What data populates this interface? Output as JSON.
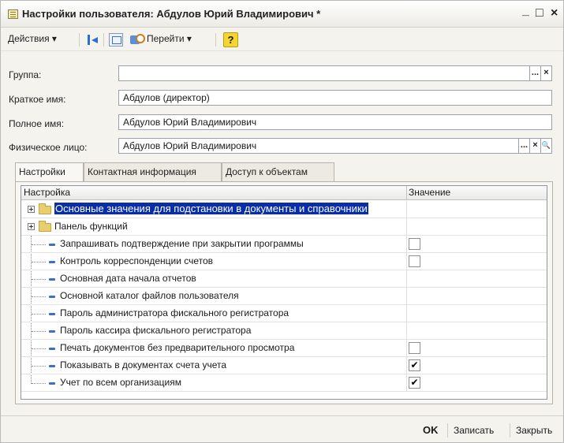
{
  "window": {
    "title": "Настройки пользователя: Абдулов Юрий Владимирович *",
    "minimize": "_",
    "maximize": "□",
    "close": "×"
  },
  "toolbar": {
    "actions_label": "Действия ▾",
    "goto_label": "Перейти ▾",
    "help_label": "?",
    "icons": [
      "back-arrow-icon",
      "edit-form-icon",
      "navigate-icon",
      "help-icon"
    ]
  },
  "form": {
    "group": {
      "label": "Группа:",
      "value": "",
      "select_btn": "...",
      "clear_btn": "×"
    },
    "short_name": {
      "label": "Краткое имя:",
      "value": "Абдулов (директор)"
    },
    "full_name": {
      "label": "Полное имя:",
      "value": "Абдулов Юрий Владимирович"
    },
    "person": {
      "label": "Физическое лицо:",
      "value": "Абдулов Юрий Владимирович",
      "select_btn": "...",
      "clear_btn": "×",
      "open_btn": "🔍"
    }
  },
  "tabs": [
    {
      "label": "Настройки",
      "active": true
    },
    {
      "label": "Контактная информация",
      "active": false
    },
    {
      "label": "Доступ к объектам",
      "active": false
    }
  ],
  "grid": {
    "columns": [
      "Настройка",
      "Значение"
    ],
    "rows": [
      {
        "label": "Основные значения для подстановки в документы и справочники",
        "kind": "folder",
        "selected": true,
        "value": null
      },
      {
        "label": "Панель функций",
        "kind": "folder",
        "selected": false,
        "value": null
      },
      {
        "label": "Запрашивать подтверждение при закрытии программы",
        "kind": "item",
        "value": "unchecked"
      },
      {
        "label": "Контроль корреспонденции счетов",
        "kind": "item",
        "value": "unchecked"
      },
      {
        "label": "Основная дата начала отчетов",
        "kind": "item",
        "value": null
      },
      {
        "label": "Основной каталог файлов пользователя",
        "kind": "item",
        "value": null
      },
      {
        "label": "Пароль администратора фискального регистратора",
        "kind": "item",
        "value": null
      },
      {
        "label": "Пароль кассира фискального регистратора",
        "kind": "item",
        "value": null
      },
      {
        "label": "Печать документов без предварительного просмотра",
        "kind": "item",
        "value": "unchecked"
      },
      {
        "label": "Показывать в документах счета учета",
        "kind": "item",
        "value": "checked"
      },
      {
        "label": "Учет по всем организациям",
        "kind": "item",
        "value": "checked"
      }
    ],
    "check_mark": "✔"
  },
  "footer": {
    "ok_label": "OK",
    "save_label": "Записать",
    "close_label": "Закрыть"
  },
  "colors": {
    "selection": "#0a2ea8",
    "window_bg": "#f4f3ee",
    "help_yellow": "#f5d631"
  }
}
